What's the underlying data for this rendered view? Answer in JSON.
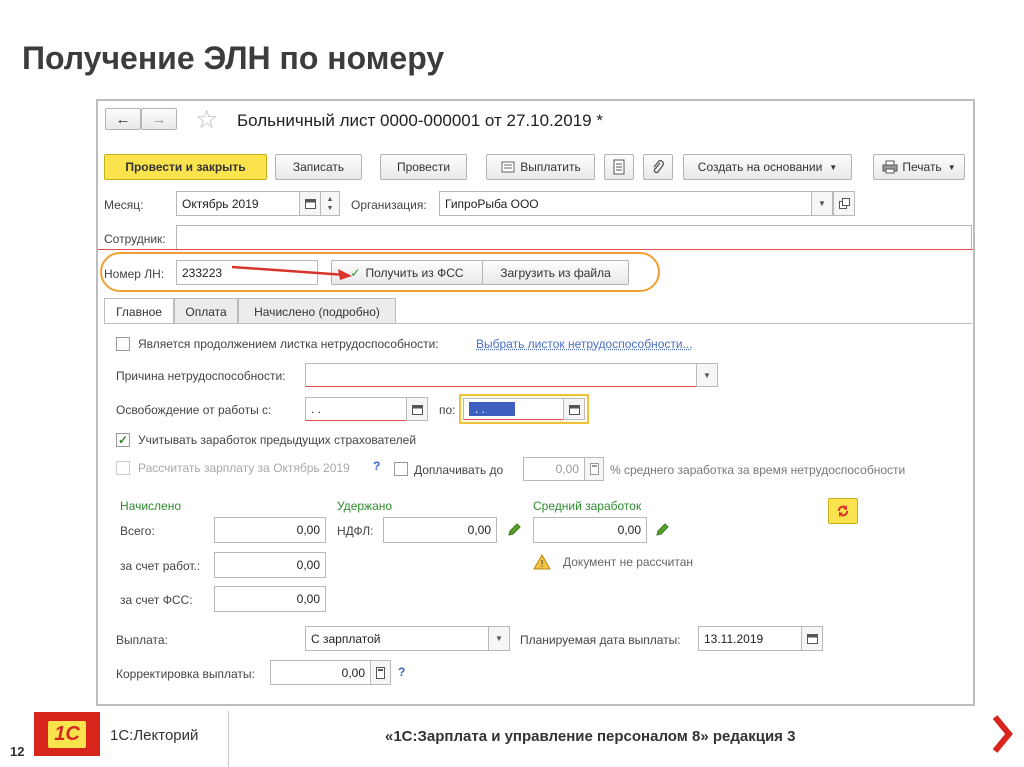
{
  "slide": {
    "title": "Получение ЭЛН по номеру",
    "page_number": "12",
    "brand_label": "1С:Лекторий",
    "course_title": "«1С:Зарплата и управление персоналом 8» редакция 3",
    "logo_text": "1С"
  },
  "window": {
    "title": "Больничный лист 0000-000001 от 27.10.2019 *",
    "star_icon": "☆",
    "nav_back": "←",
    "nav_forward": "→"
  },
  "toolbar": {
    "post_close": "Провести и закрыть",
    "save": "Записать",
    "post": "Провести",
    "pay": "Выплатить",
    "create_based": "Создать на основании",
    "print": "Печать"
  },
  "header_fields": {
    "month_label": "Месяц:",
    "month_value": "Октябрь 2019",
    "org_label": "Организация:",
    "org_value": "ГипроРыба ООО",
    "employee_label": "Сотрудник:",
    "ln_label": "Номер ЛН:",
    "ln_value": "233223",
    "get_fss": "Получить из ФСС",
    "load_file": "Загрузить из файла"
  },
  "tabs": [
    "Главное",
    "Оплата",
    "Начислено (подробно)"
  ],
  "main": {
    "continuation_label": "Является продолжением листка нетрудоспособности:",
    "choose_link": "Выбрать листок нетрудоспособности...",
    "reason_label": "Причина нетрудоспособности:",
    "release_label": "Освобождение от работы с:",
    "release_from": " .  .",
    "to_label": "по:",
    "release_to": " .  .",
    "consider_label": "Учитывать заработок предыдущих страхователей",
    "calc_salary_label": "Рассчитать зарплату за Октябрь 2019",
    "help": "?",
    "extra_pay_label": "Доплачивать до",
    "extra_pay_value": "0,00",
    "extra_pay_suffix": "% среднего заработка за время нетрудоспособности",
    "accrued_header": "Начислено",
    "withheld_header": "Удержано",
    "avg_header": "Средний заработок",
    "total_label": "Всего:",
    "total_value": "0,00",
    "ndfl_label": "НДФЛ:",
    "ndfl_value": "0,00",
    "avg_value": "0,00",
    "employer_label": "за счет работ.:",
    "employer_value": "0,00",
    "fss_label": "за счет ФСС:",
    "fss_value": "0,00",
    "warning_text": "Документ не рассчитан",
    "payout_label": "Выплата:",
    "payout_value": "С зарплатой",
    "planned_date_label": "Планируемая дата выплаты:",
    "planned_date_value": "13.11.2019",
    "correction_label": "Корректировка выплаты:",
    "correction_value": "0,00"
  },
  "colors": {
    "accent_yellow": "#fbe34d",
    "highlight_orange": "#f0a030",
    "arrow_red": "#d9342b",
    "logo_red": "#d9261c",
    "green": "#2e8b2e"
  }
}
